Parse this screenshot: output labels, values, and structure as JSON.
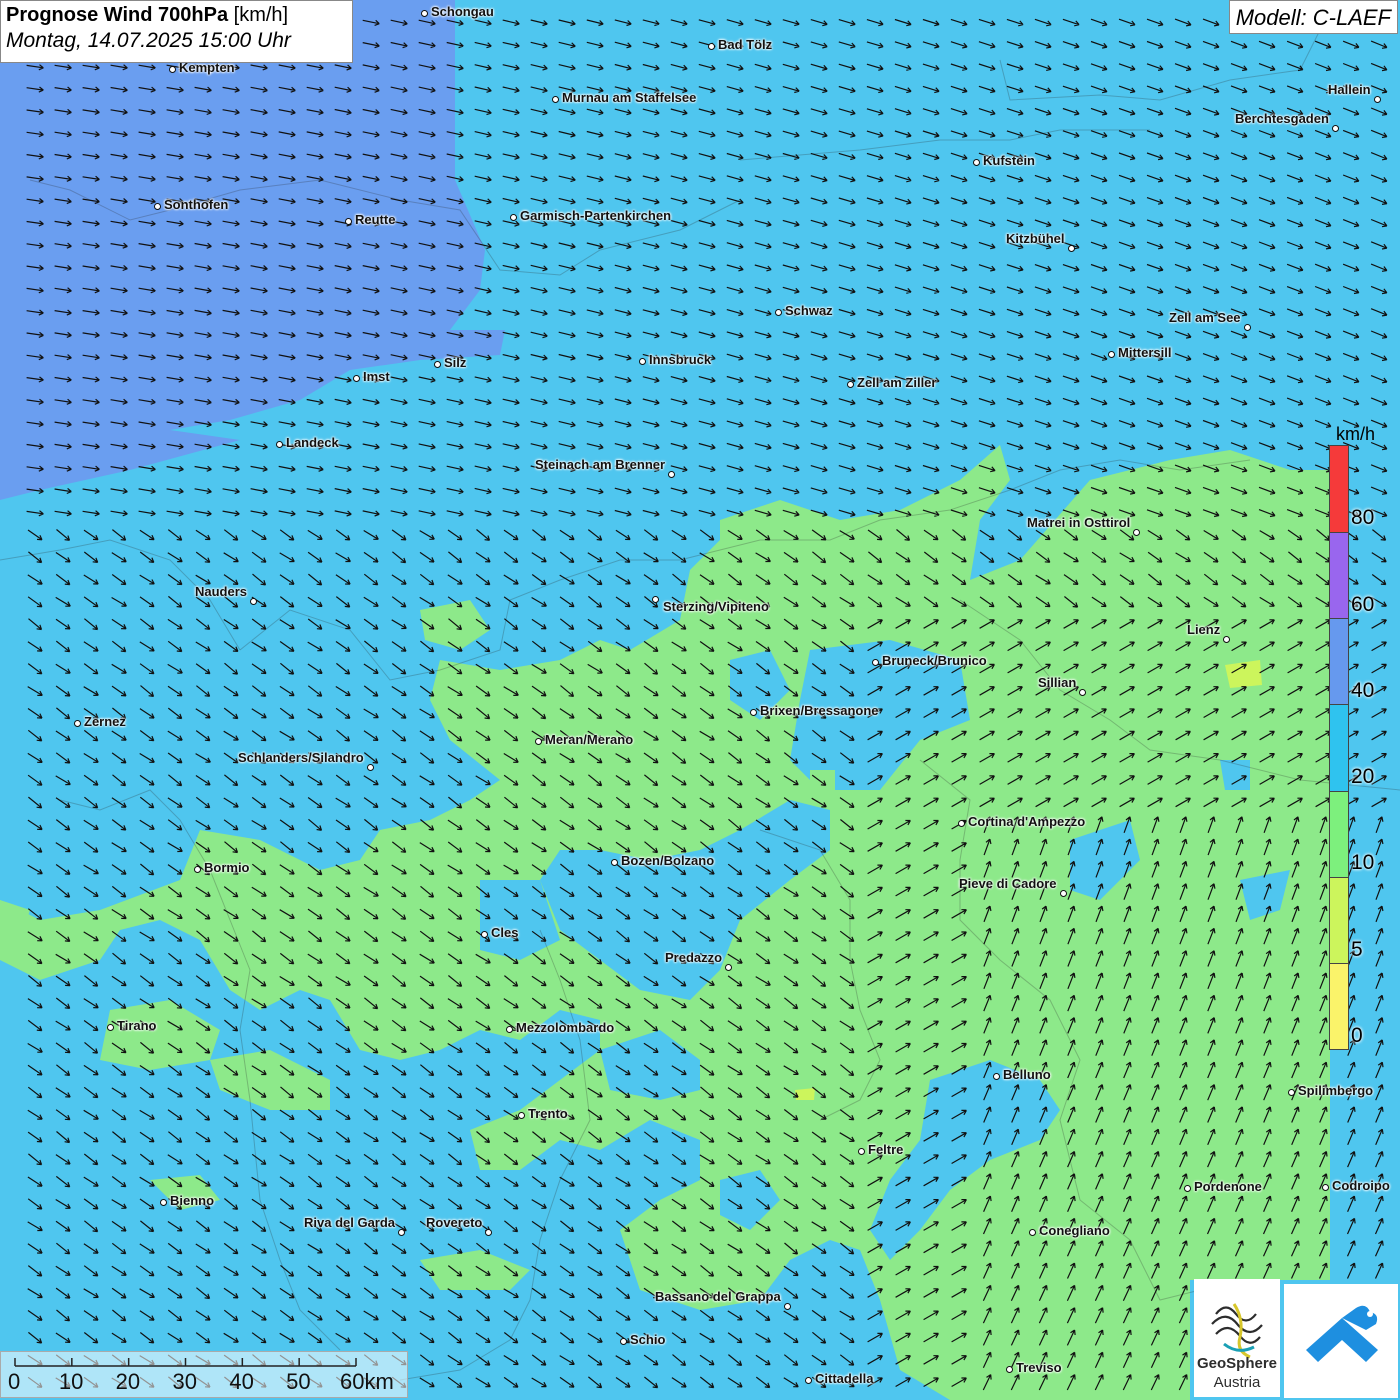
{
  "header": {
    "title_bold": "Prognose Wind 700hPa",
    "title_unit": "[km/h]",
    "datetime": "Montag, 14.07.2025 15:00 Uhr",
    "model": "Modell: C-LAEF"
  },
  "legend": {
    "unit": "km/h",
    "labels": [
      "80",
      "60",
      "40",
      "20",
      "10",
      "5",
      "0"
    ],
    "colors": [
      "#f53a3a",
      "#9966ee",
      "#6699ee",
      "#2fc3ef",
      "#7df07d",
      "#ccf55c",
      "#faf36a"
    ]
  },
  "scalebar": {
    "labels": [
      "0",
      "10",
      "20",
      "30",
      "40",
      "50",
      "60km"
    ]
  },
  "logo": {
    "name_line1": "GeoSphere",
    "name_line2": "Austria"
  },
  "cities": [
    {
      "name": "Schongau"
    },
    {
      "name": "Bad Tölz"
    },
    {
      "name": "Kempten"
    },
    {
      "name": "Murnau am Staffelsee"
    },
    {
      "name": "Hallein"
    },
    {
      "name": "Berchtesgaden"
    },
    {
      "name": "Kufstein"
    },
    {
      "name": "Sonthofen"
    },
    {
      "name": "Reutte"
    },
    {
      "name": "Garmisch-Partenkirchen"
    },
    {
      "name": "Kitzbühel"
    },
    {
      "name": "Schwaz"
    },
    {
      "name": "Zell am See"
    },
    {
      "name": "Mittersill"
    },
    {
      "name": "Imst"
    },
    {
      "name": "Silz"
    },
    {
      "name": "Innsbruck"
    },
    {
      "name": "Zell am Ziller"
    },
    {
      "name": "Landeck"
    },
    {
      "name": "Steinach am Brenner"
    },
    {
      "name": "Matrei in Osttirol"
    },
    {
      "name": "Nauders"
    },
    {
      "name": "Sterzing/Vipiteno"
    },
    {
      "name": "Lienz"
    },
    {
      "name": "Bruneck/Brunico"
    },
    {
      "name": "Sillian"
    },
    {
      "name": "Brixen/Bressanone"
    },
    {
      "name": "Zernez"
    },
    {
      "name": "Meran/Merano"
    },
    {
      "name": "Schlanders/Silandro"
    },
    {
      "name": "Cortina d'Ampezzo"
    },
    {
      "name": "Bozen/Bolzano"
    },
    {
      "name": "Bormio"
    },
    {
      "name": "Pieve di Cadore"
    },
    {
      "name": "Cles"
    },
    {
      "name": "Predazzo"
    },
    {
      "name": "Tirano"
    },
    {
      "name": "Mezzolombardo"
    },
    {
      "name": "Belluno"
    },
    {
      "name": "Spilimbergo"
    },
    {
      "name": "Trento"
    },
    {
      "name": "Feltre"
    },
    {
      "name": "Pordenone"
    },
    {
      "name": "Codroipo"
    },
    {
      "name": "Bienno"
    },
    {
      "name": "Riva del Garda"
    },
    {
      "name": "Rovereto"
    },
    {
      "name": "Conegliano"
    },
    {
      "name": "Bassano del Grappa"
    },
    {
      "name": "Schio"
    },
    {
      "name": "Treviso"
    },
    {
      "name": "Cittadella"
    }
  ]
}
